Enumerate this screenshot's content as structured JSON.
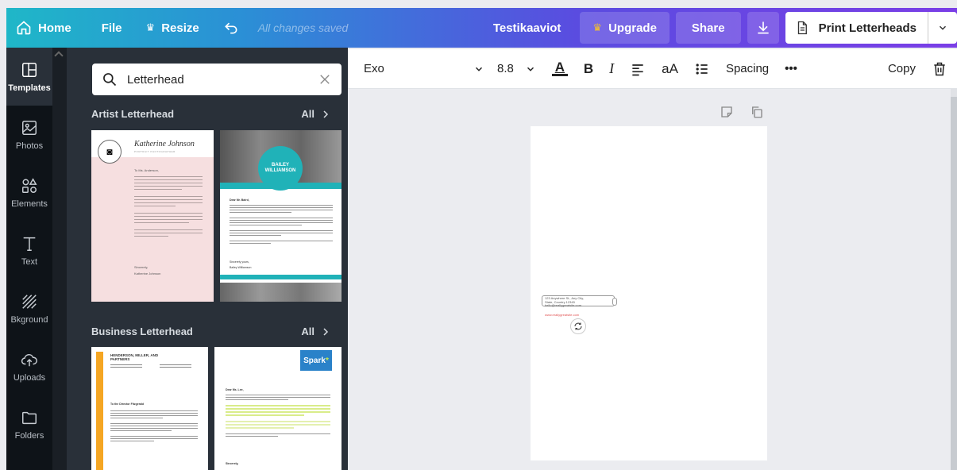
{
  "topbar": {
    "home": "Home",
    "file": "File",
    "resize": "Resize",
    "saved_status": "All changes saved",
    "doc_name": "Testikaaviot",
    "upgrade": "Upgrade",
    "share": "Share",
    "print": "Print Letterheads"
  },
  "nav": [
    {
      "label": "Templates",
      "icon": "templates-icon"
    },
    {
      "label": "Photos",
      "icon": "photos-icon"
    },
    {
      "label": "Elements",
      "icon": "elements-icon"
    },
    {
      "label": "Text",
      "icon": "text-icon"
    },
    {
      "label": "Bkground",
      "icon": "background-icon"
    },
    {
      "label": "Uploads",
      "icon": "uploads-icon"
    },
    {
      "label": "Folders",
      "icon": "folders-icon"
    }
  ],
  "search": {
    "value": "Letterhead"
  },
  "sections": [
    {
      "title": "Artist Letterhead",
      "all": "All"
    },
    {
      "title": "Business Letterhead",
      "all": "All"
    }
  ],
  "templates": {
    "artist_1": {
      "name": "Katherine Johnson",
      "role": "PORTRAIT PHOTOGRAPHER",
      "greeting": "To Ms. Anderson,",
      "sign": "Sincerely,",
      "signer": "Katherine Johnson"
    },
    "artist_2": {
      "name": "BAILEY WILLIAMSON",
      "greeting": "Dear Mr. Baird,",
      "sign": "Sincerely yours,",
      "signer": "Bailey Williamson"
    },
    "business_1": {
      "name": "HENDERSON, MILLER, AND PARTNERS",
      "greeting": "To the Director Fitzgerald"
    },
    "business_2": {
      "brand": "Spark",
      "greeting": "Dear Ms. Lee,",
      "sign": "Sincerely,"
    }
  },
  "toolbar": {
    "font": "Exo",
    "size": "8.8",
    "bold": "B",
    "italic": "I",
    "case": "aA",
    "spacing": "Spacing",
    "more": "•••",
    "copy": "Copy"
  },
  "page": {
    "address_line1": "123 Anywhere St., Any City,",
    "address_line2": "State, Country 12345",
    "address_line3": "hello@reallygreatsite.com",
    "web": "www.reallygreatsite.com"
  },
  "colors": {
    "accent_teal": "#1fb7c8",
    "accent_purple": "#7a3ee6",
    "nav_bg": "#0e1318",
    "panel_bg": "#293039"
  }
}
